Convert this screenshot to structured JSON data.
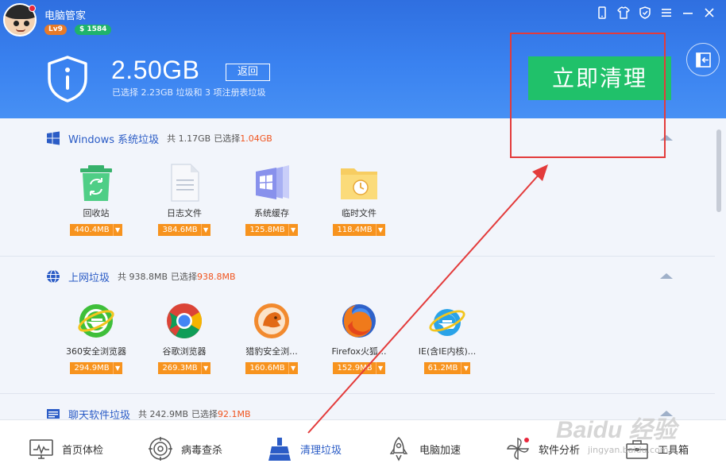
{
  "app": {
    "title": "电脑管家",
    "level": "Lv9",
    "coins": "$ 1584"
  },
  "window_icons": [
    "phone-icon",
    "shirt-icon",
    "shield-icon",
    "menu-icon",
    "minimize-icon",
    "close-icon"
  ],
  "summary": {
    "size": "2.50GB",
    "back_label": "返回",
    "description": "已选择 2.23GB 垃圾和 3 项注册表垃圾"
  },
  "clean_button": "立即清理",
  "sections": [
    {
      "title": "Windows 系统垃圾",
      "total": "共 1.17GB",
      "selected_label": "已选择",
      "selected_value": "1.04GB",
      "items": [
        {
          "label": "回收站",
          "size": "440.4MB",
          "icon": "recycle-bin-icon"
        },
        {
          "label": "日志文件",
          "size": "384.6MB",
          "icon": "log-file-icon"
        },
        {
          "label": "系统缓存",
          "size": "125.8MB",
          "icon": "system-cache-icon"
        },
        {
          "label": "临时文件",
          "size": "118.4MB",
          "icon": "temp-folder-icon"
        }
      ]
    },
    {
      "title": "上网垃圾",
      "total": "共 938.8MB",
      "selected_label": "已选择",
      "selected_value": "938.8MB",
      "items": [
        {
          "label": "360安全浏览器",
          "size": "294.9MB",
          "icon": "360-browser-icon"
        },
        {
          "label": "谷歌浏览器",
          "size": "269.3MB",
          "icon": "chrome-icon"
        },
        {
          "label": "猎豹安全浏...",
          "size": "160.6MB",
          "icon": "liebao-browser-icon"
        },
        {
          "label": "Firefox火狐...",
          "size": "152.9MB",
          "icon": "firefox-icon"
        },
        {
          "label": "IE(含IE内核)...",
          "size": "61.2MB",
          "icon": "ie-icon"
        }
      ]
    },
    {
      "title": "聊天软件垃圾",
      "total": "共 242.9MB",
      "selected_label": "已选择",
      "selected_value": "92.1MB",
      "items": []
    }
  ],
  "nav": [
    {
      "label": "首页体检",
      "icon": "monitor-icon"
    },
    {
      "label": "病毒查杀",
      "icon": "virus-scan-icon"
    },
    {
      "label": "清理垃圾",
      "icon": "broom-icon"
    },
    {
      "label": "电脑加速",
      "icon": "rocket-icon"
    },
    {
      "label": "软件分析",
      "icon": "pinwheel-icon"
    },
    {
      "label": "工具箱",
      "icon": "toolbox-icon"
    }
  ],
  "watermark": {
    "text": "Baidu 经验",
    "url": "jingyan.baidu.com"
  },
  "colors": {
    "header_blue": "#3a82f0",
    "clean_green": "#20c16a",
    "size_orange": "#f7931e",
    "highlight_red": "#e33b3b",
    "link_blue": "#2b5cc6"
  }
}
